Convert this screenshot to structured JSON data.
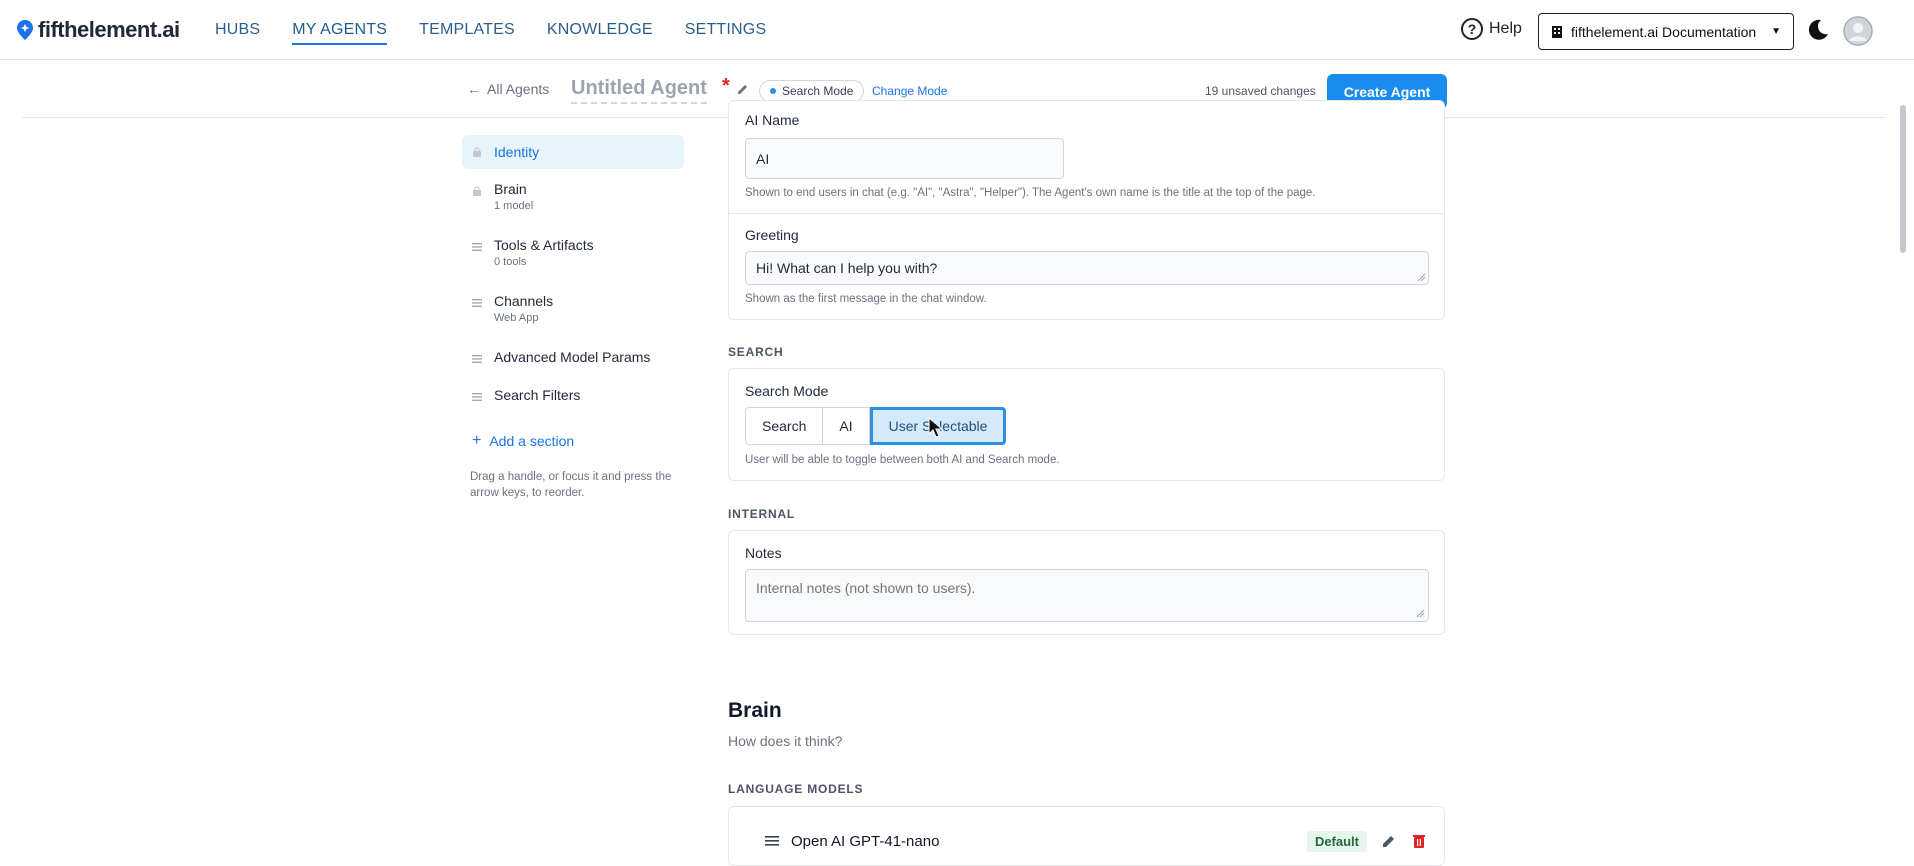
{
  "nav": {
    "brand": "fifthelement.ai",
    "links": [
      {
        "label": "HUBS",
        "active": false
      },
      {
        "label": "MY AGENTS",
        "active": true
      },
      {
        "label": "TEMPLATES",
        "active": false
      },
      {
        "label": "KNOWLEDGE",
        "active": false
      },
      {
        "label": "SETTINGS",
        "active": false
      }
    ],
    "help_label": "Help",
    "doc_selector": "fifthelement.ai Documentation"
  },
  "subbar": {
    "back_label": "All Agents",
    "agent_title": "Untitled Agent",
    "required_mark": "*",
    "mode_chip": "Search Mode",
    "change_mode": "Change Mode",
    "unsaved": "19 unsaved changes",
    "create_label": "Create Agent"
  },
  "sidebar": {
    "items": [
      {
        "label": "Identity",
        "sub": "",
        "active": true,
        "icon": "lock-icon"
      },
      {
        "label": "Brain",
        "sub": "1 model",
        "active": false,
        "icon": "lock-icon"
      },
      {
        "label": "Tools & Artifacts",
        "sub": "0 tools",
        "active": false,
        "icon": "drag-handle-icon"
      },
      {
        "label": "Channels",
        "sub": "Web App",
        "active": false,
        "icon": "drag-handle-icon"
      },
      {
        "label": "Advanced Model Params",
        "sub": "",
        "active": false,
        "icon": "drag-handle-icon"
      },
      {
        "label": "Search Filters",
        "sub": "",
        "active": false,
        "icon": "drag-handle-icon"
      }
    ],
    "add_section": "Add a section",
    "drag_hint": "Drag a handle, or focus it and press the arrow keys, to reorder."
  },
  "identity": {
    "ai_name_label": "AI Name",
    "ai_name_value": "AI",
    "ai_name_hint": "Shown to end users in chat (e.g. \"AI\", \"Astra\", \"Helper\"). The Agent's own name is the title at the top of the page.",
    "greeting_label": "Greeting",
    "greeting_value": "Hi! What can I help you with?",
    "greeting_hint": "Shown as the first message in the chat window."
  },
  "search": {
    "section_title": "SEARCH",
    "mode_label": "Search Mode",
    "options": [
      "Search",
      "AI",
      "User Selectable"
    ],
    "selected": "User Selectable",
    "hint": "User will be able to toggle between both AI and Search mode."
  },
  "internal": {
    "section_title": "INTERNAL",
    "notes_label": "Notes",
    "notes_placeholder": "Internal notes (not shown to users)."
  },
  "brain": {
    "title": "Brain",
    "subtitle": "How does it think?",
    "section_title": "LANGUAGE MODELS",
    "models": [
      {
        "name": "Open AI GPT-41-nano",
        "badge": "Default"
      }
    ]
  },
  "colors": {
    "accent": "#1a8cf0",
    "link": "#1a73e8",
    "danger": "#dc2626",
    "active_bg": "#e8f4fc"
  }
}
